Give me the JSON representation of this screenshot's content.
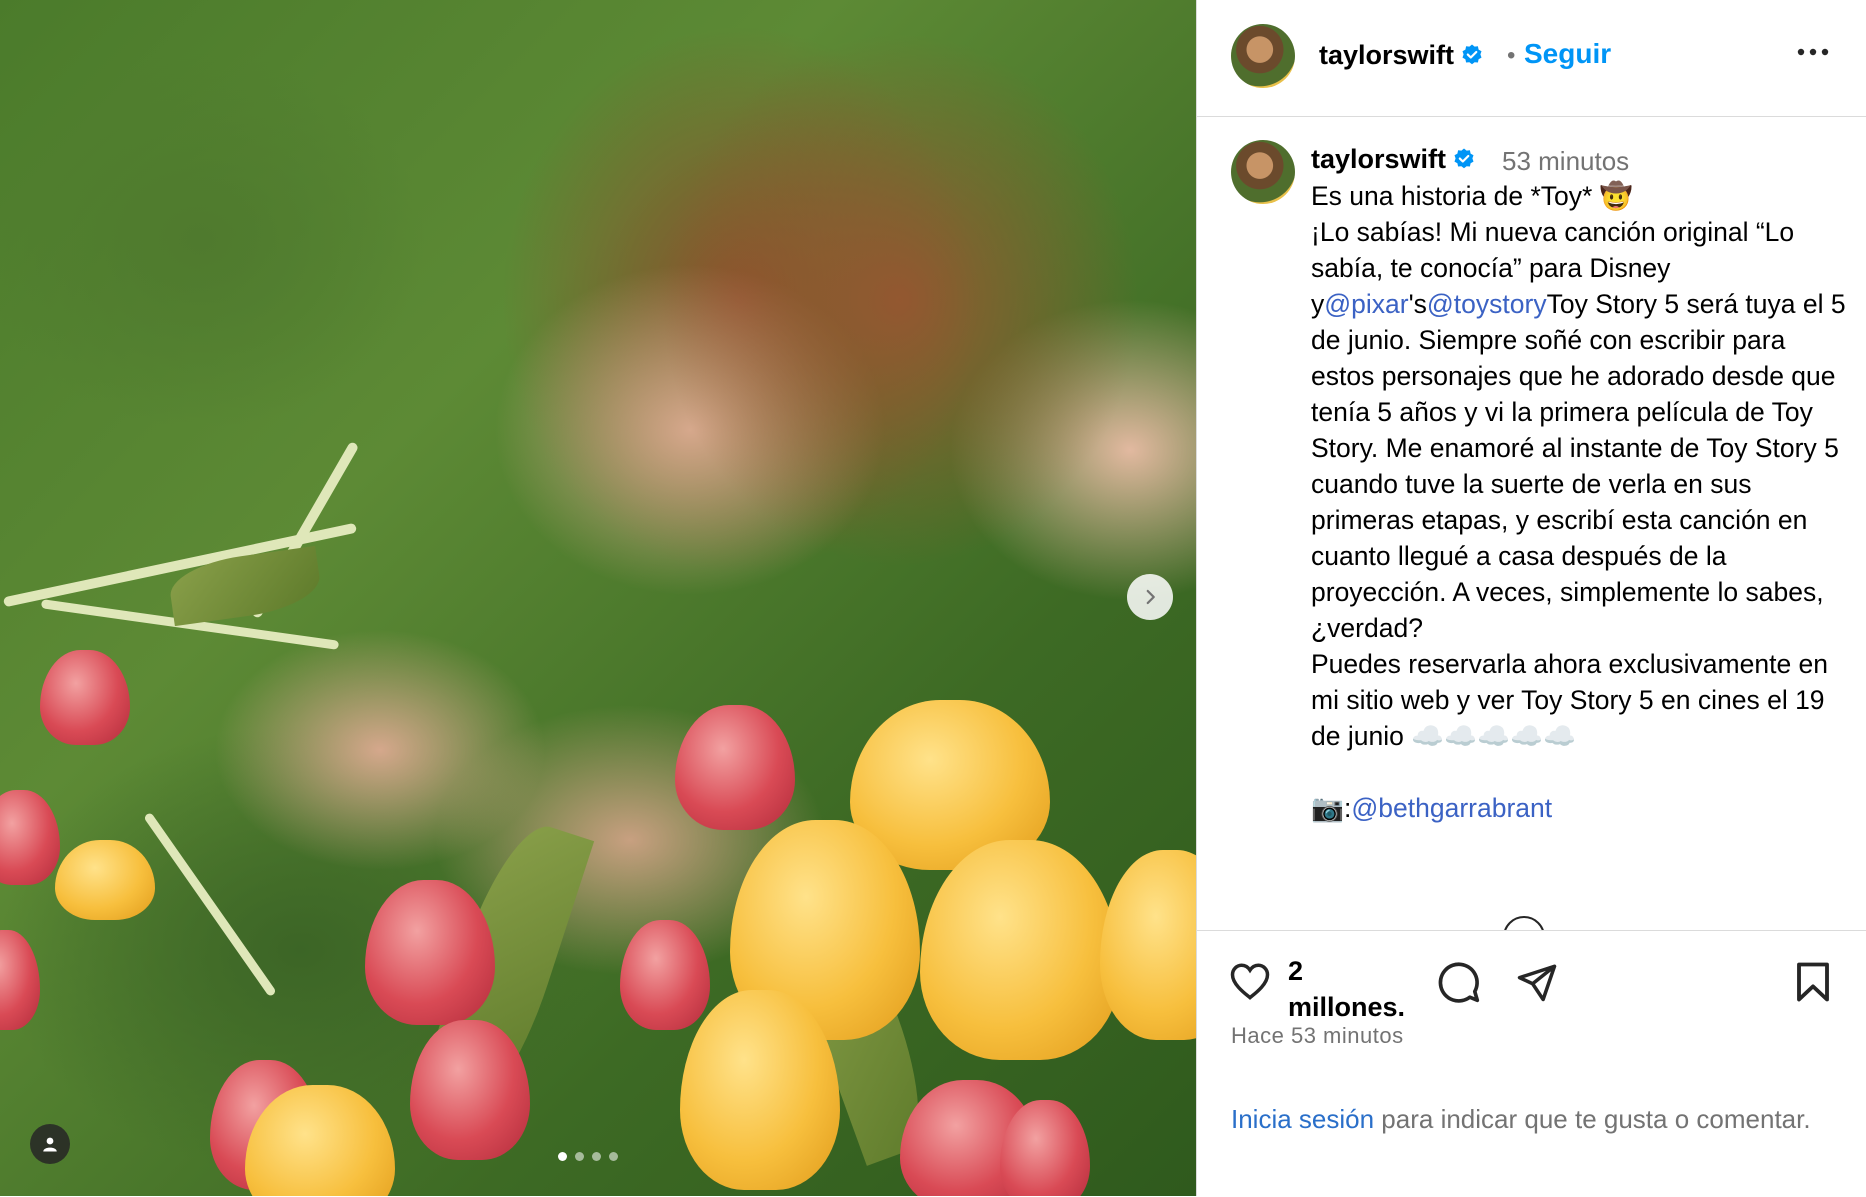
{
  "post": {
    "carousel": {
      "total_slides": 4,
      "active_slide": 1
    }
  },
  "header": {
    "username": "taylorswift",
    "separator": "•",
    "follow_label": "Seguir"
  },
  "caption": {
    "username": "taylorswift",
    "time": "53 minutos",
    "line1": "Es una historia de *Toy* 🤠",
    "p2_before": "¡Lo sabías! Mi nueva canción original “Lo sabía, te conocía” para Disney y",
    "mention_pixar": "@pixar",
    "p2_mid": "'s",
    "mention_toystory": "@toystory",
    "p2_after": "Toy Story 5 será tuya el 5 de junio. Siempre soñé con escribir para estos personajes que he adorado desde que tenía 5 años y vi la primera película de Toy Story. Me enamoré al instante de Toy Story 5 cuando tuve la suerte de verla en sus primeras etapas, y escribí esta canción en cuanto llegué a casa después de la proyección. A veces, simplemente lo sabes, ¿verdad?",
    "p3": "Puedes reservarla ahora exclusivamente en mi sitio web y ver Toy Story 5 en cines el 19 de junio ☁️☁️☁️☁️☁️",
    "photo_credit_emoji": "📷:",
    "mention_photographer": "@bethgarrabrant"
  },
  "actions": {
    "likes_number": "2",
    "likes_unit": "millones.",
    "posted_ago": "Hace 53 minutos"
  },
  "login_prompt": {
    "link": "Inicia sesión",
    "rest": " para indicar que te gusta o comentar."
  },
  "colors": {
    "accent": "#0095f6",
    "verified": "#0095f6",
    "secondary_text": "#737373",
    "border": "#dbdbdb"
  },
  "icons": [
    "next-chevron-icon",
    "tagged-user-icon",
    "verified-badge-icon",
    "more-options-icon",
    "heart-icon",
    "comment-icon",
    "share-icon",
    "bookmark-icon"
  ]
}
